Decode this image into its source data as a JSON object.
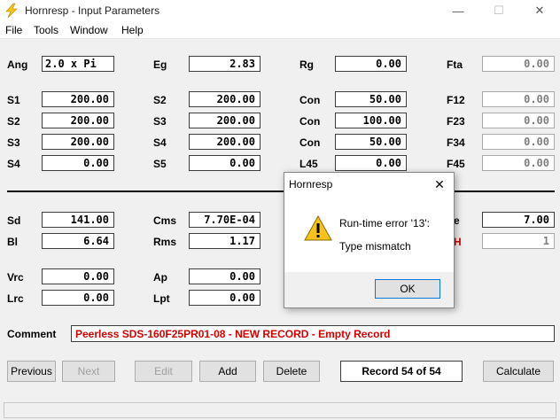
{
  "window": {
    "title": "Hornresp - Input Parameters",
    "minimize": "—",
    "maximize": "☐",
    "close": "✕"
  },
  "menu": [
    "File",
    "Tools",
    "Window",
    "Help"
  ],
  "params": {
    "Ang": {
      "label": "Ang",
      "value": "2.0 x Pi"
    },
    "Eg": {
      "label": "Eg",
      "value": "2.83"
    },
    "Rg": {
      "label": "Rg",
      "value": "0.00"
    },
    "Fta": {
      "label": "Fta",
      "value": "0.00"
    },
    "S1": {
      "label": "S1",
      "value": "200.00"
    },
    "S2a": {
      "label": "S2",
      "value": "200.00"
    },
    "Con1": {
      "label": "Con",
      "value": "50.00"
    },
    "F12": {
      "label": "F12",
      "value": "0.00"
    },
    "S2": {
      "label": "S2",
      "value": "200.00"
    },
    "S3a": {
      "label": "S3",
      "value": "200.00"
    },
    "Con2": {
      "label": "Con",
      "value": "100.00"
    },
    "F23": {
      "label": "F23",
      "value": "0.00"
    },
    "S3": {
      "label": "S3",
      "value": "200.00"
    },
    "S4a": {
      "label": "S4",
      "value": "200.00"
    },
    "Con3": {
      "label": "Con",
      "value": "50.00"
    },
    "F34": {
      "label": "F34",
      "value": "0.00"
    },
    "S4": {
      "label": "S4",
      "value": "0.00"
    },
    "S5": {
      "label": "S5",
      "value": "0.00"
    },
    "L45": {
      "label": "L45",
      "value": "0.00"
    },
    "F45": {
      "label": "F45",
      "value": "0.00"
    },
    "Sd": {
      "label": "Sd",
      "value": "141.00"
    },
    "Cms": {
      "label": "Cms",
      "value": "7.70E-04"
    },
    "Re": {
      "label": "e",
      "value": "7.00"
    },
    "Bl": {
      "label": "Bl",
      "value": "6.64"
    },
    "Rms": {
      "label": "Rms",
      "value": "1.17"
    },
    "N": {
      "label": "H",
      "value": "1"
    },
    "Vrc": {
      "label": "Vrc",
      "value": "0.00"
    },
    "Ap": {
      "label": "Ap",
      "value": "0.00"
    },
    "Lrc": {
      "label": "Lrc",
      "value": "0.00"
    },
    "Lpt": {
      "label": "Lpt",
      "value": "0.00"
    }
  },
  "comment": {
    "label": "Comment",
    "value": "Peerless SDS-160F25PR01-08 - NEW RECORD - Empty Record"
  },
  "buttons": {
    "previous": "Previous",
    "next": "Next",
    "edit": "Edit",
    "add": "Add",
    "delete": "Delete",
    "calculate": "Calculate"
  },
  "record": "Record 54 of 54",
  "dialog": {
    "title": "Hornresp",
    "close": "✕",
    "message": "Run-time error '13':",
    "detail": "Type mismatch",
    "ok": "OK"
  },
  "colors": {
    "accent": "#0078d7",
    "label_red": "#d40000",
    "comment_red": "#d40000",
    "warning": "#f7c21b"
  }
}
